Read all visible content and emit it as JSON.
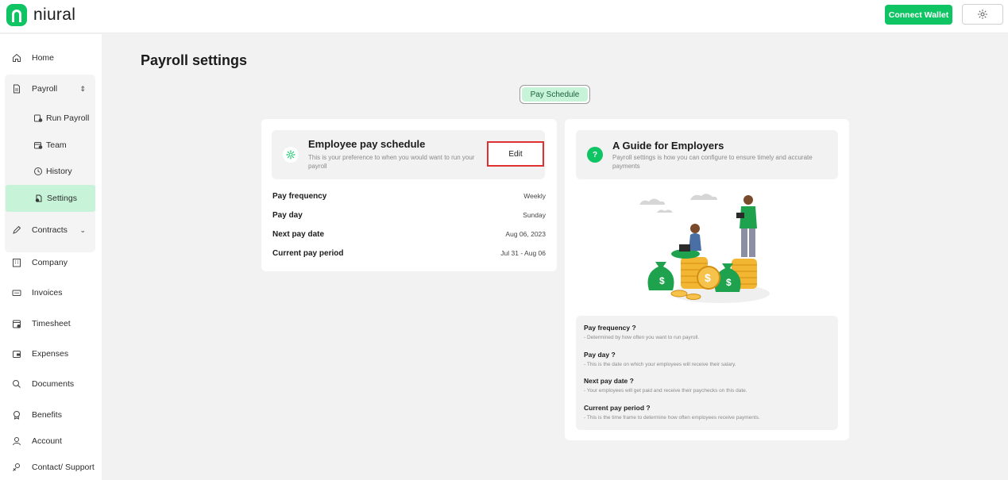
{
  "header": {
    "logo_text": "niural",
    "connect_wallet": "Connect Wallet",
    "theme_icon": "sun-icon",
    "brand_color": "#0ec463"
  },
  "sidebar": {
    "items": [
      {
        "label": "Home",
        "icon": "home-icon"
      },
      {
        "label": "Payroll",
        "icon": "document-icon"
      },
      {
        "label": "Contracts",
        "icon": "pen-icon"
      },
      {
        "label": "Company",
        "icon": "building-icon"
      },
      {
        "label": "Invoices",
        "icon": "ticket-icon"
      },
      {
        "label": "Timesheet",
        "icon": "calendar-icon"
      },
      {
        "label": "Expenses",
        "icon": "wallet-icon"
      },
      {
        "label": "Documents",
        "icon": "search-icon"
      },
      {
        "label": "Benefits",
        "icon": "medal-icon"
      },
      {
        "label": "Account",
        "icon": "user-icon"
      },
      {
        "label": "Contact/ Support",
        "icon": "support-icon"
      }
    ],
    "payroll_sub": [
      {
        "label": "Run Payroll",
        "icon": "run-payroll-icon"
      },
      {
        "label": "Team",
        "icon": "team-icon"
      },
      {
        "label": "History",
        "icon": "history-icon"
      },
      {
        "label": "Settings",
        "icon": "settings-icon"
      }
    ],
    "active_item": "Settings",
    "active_color": "#c7f4d9"
  },
  "main": {
    "title": "Payroll settings",
    "tab": "Pay Schedule",
    "schedule": {
      "title": "Employee pay schedule",
      "description": "This is your preference to when you would want to run your payroll",
      "edit_label": "Edit",
      "rows": [
        {
          "label": "Pay frequency",
          "value": "Weekly"
        },
        {
          "label": "Pay day",
          "value": "Sunday"
        },
        {
          "label": "Next pay date",
          "value": "Aug 06, 2023"
        },
        {
          "label": "Current pay period",
          "value": "Jul 31 - Aug 06"
        }
      ]
    },
    "guide": {
      "title": "A Guide for Employers",
      "description": "Payroll settings is how you can configure to ensure timely and accurate payments",
      "faq": [
        {
          "q": "Pay frequency ?",
          "a": "- Determined by how often you want to run payroll."
        },
        {
          "q": "Pay day ?",
          "a": "- This is the date on which your employees will receive their salary."
        },
        {
          "q": "Next pay date ?",
          "a": "- Your employees will get paid and receive their paychecks on this date."
        },
        {
          "q": "Current pay period ?",
          "a": "- This is the time frame to determine how often employees receive payments."
        }
      ]
    }
  }
}
